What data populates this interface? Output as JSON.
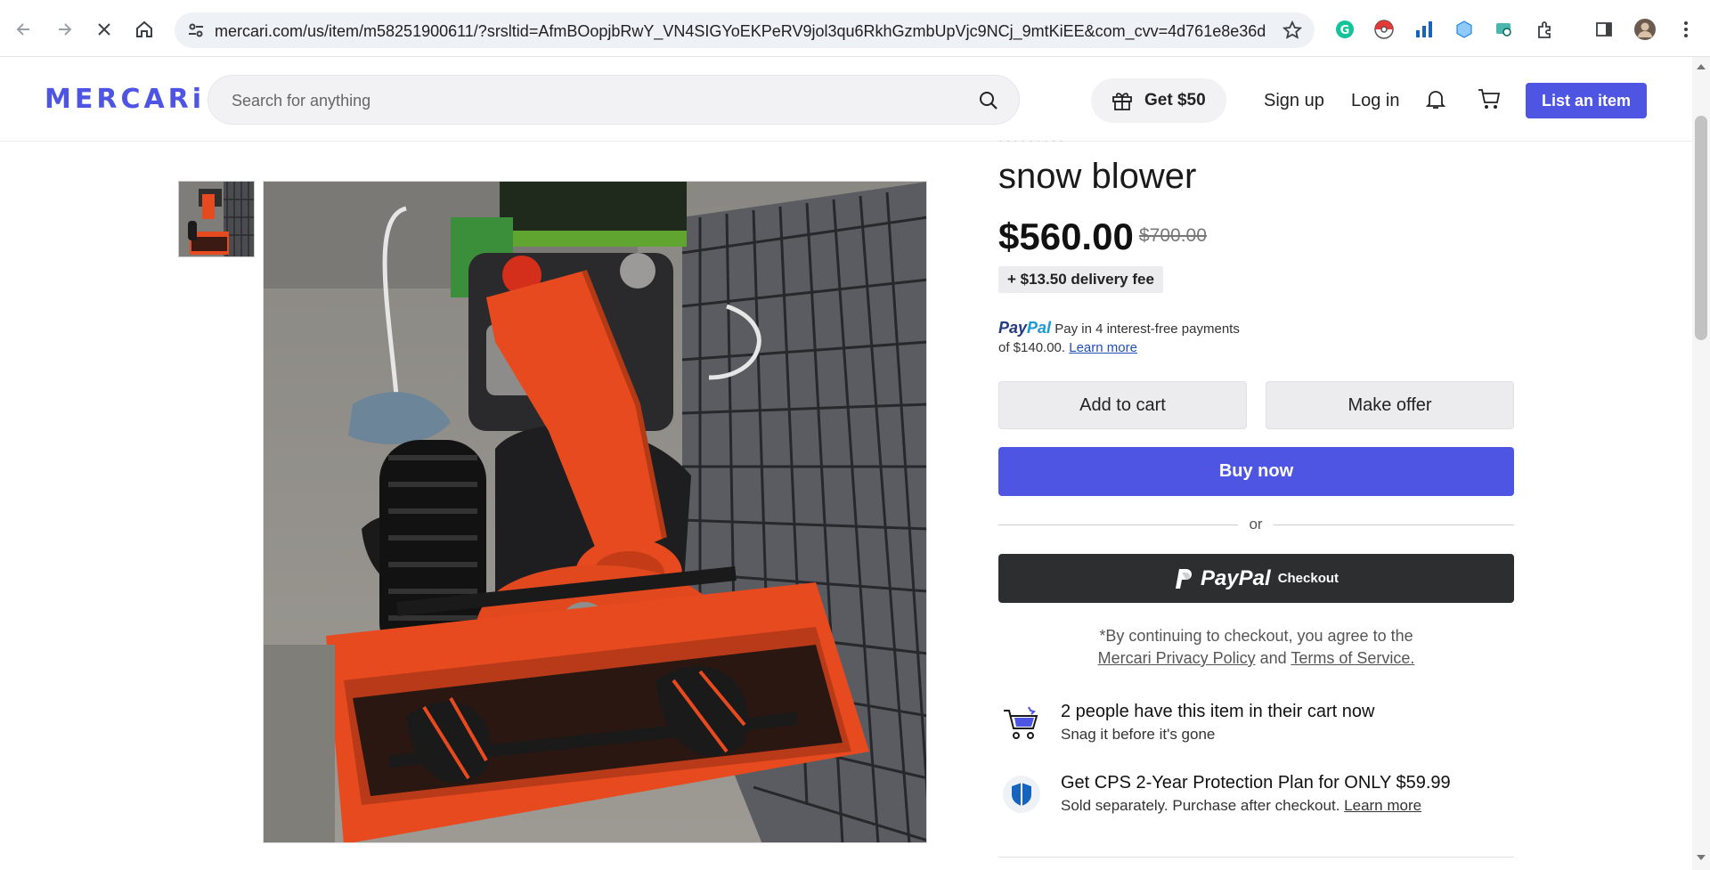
{
  "browser": {
    "url": "mercari.com/us/item/m58251900611/?srsltid=AfmBOopjbRwY_VN4SIGYoEKPeRV9jol3qu6RkhGzmbUpVjc9NCj_9mtKiEE&com_cvv=4d761e8e36d2c5242..."
  },
  "header": {
    "logo": "MERCARi",
    "search_placeholder": "Search for anything",
    "get_reward": "Get $50",
    "sign_up": "Sign up",
    "log_in": "Log in",
    "list_item": "List an item"
  },
  "product": {
    "title": "snow blower",
    "price": "$560.00",
    "original_price": "$700.00",
    "delivery_fee": "+ $13.50 delivery fee",
    "paypal_pay": "Pay",
    "paypal_pal": "Pal",
    "paypal_installments": "Pay in 4 interest-free payments",
    "paypal_amount": "of $140.00.",
    "learn_more": "Learn more",
    "add_to_cart": "Add to cart",
    "make_offer": "Make offer",
    "buy_now": "Buy now",
    "or": "or",
    "paypal_checkout_word": "PayPal",
    "paypal_checkout": "Checkout",
    "terms_prefix": "*By continuing to checkout, you agree to the",
    "privacy_policy": "Mercari Privacy Policy",
    "and": "and",
    "terms_of_service": "Terms of Service."
  },
  "promos": [
    {
      "title": "2 people have this item in their cart now",
      "subtitle": "Snag it before it's gone"
    },
    {
      "title": "Get CPS 2-Year Protection Plan for ONLY $59.99",
      "subtitle": "Sold separately. Purchase after checkout.",
      "link": "Learn more"
    }
  ],
  "colors": {
    "brand": "#4d55e2",
    "paypal_dark": "#2c2e2f",
    "snowblower_orange": "#e84a1f"
  }
}
